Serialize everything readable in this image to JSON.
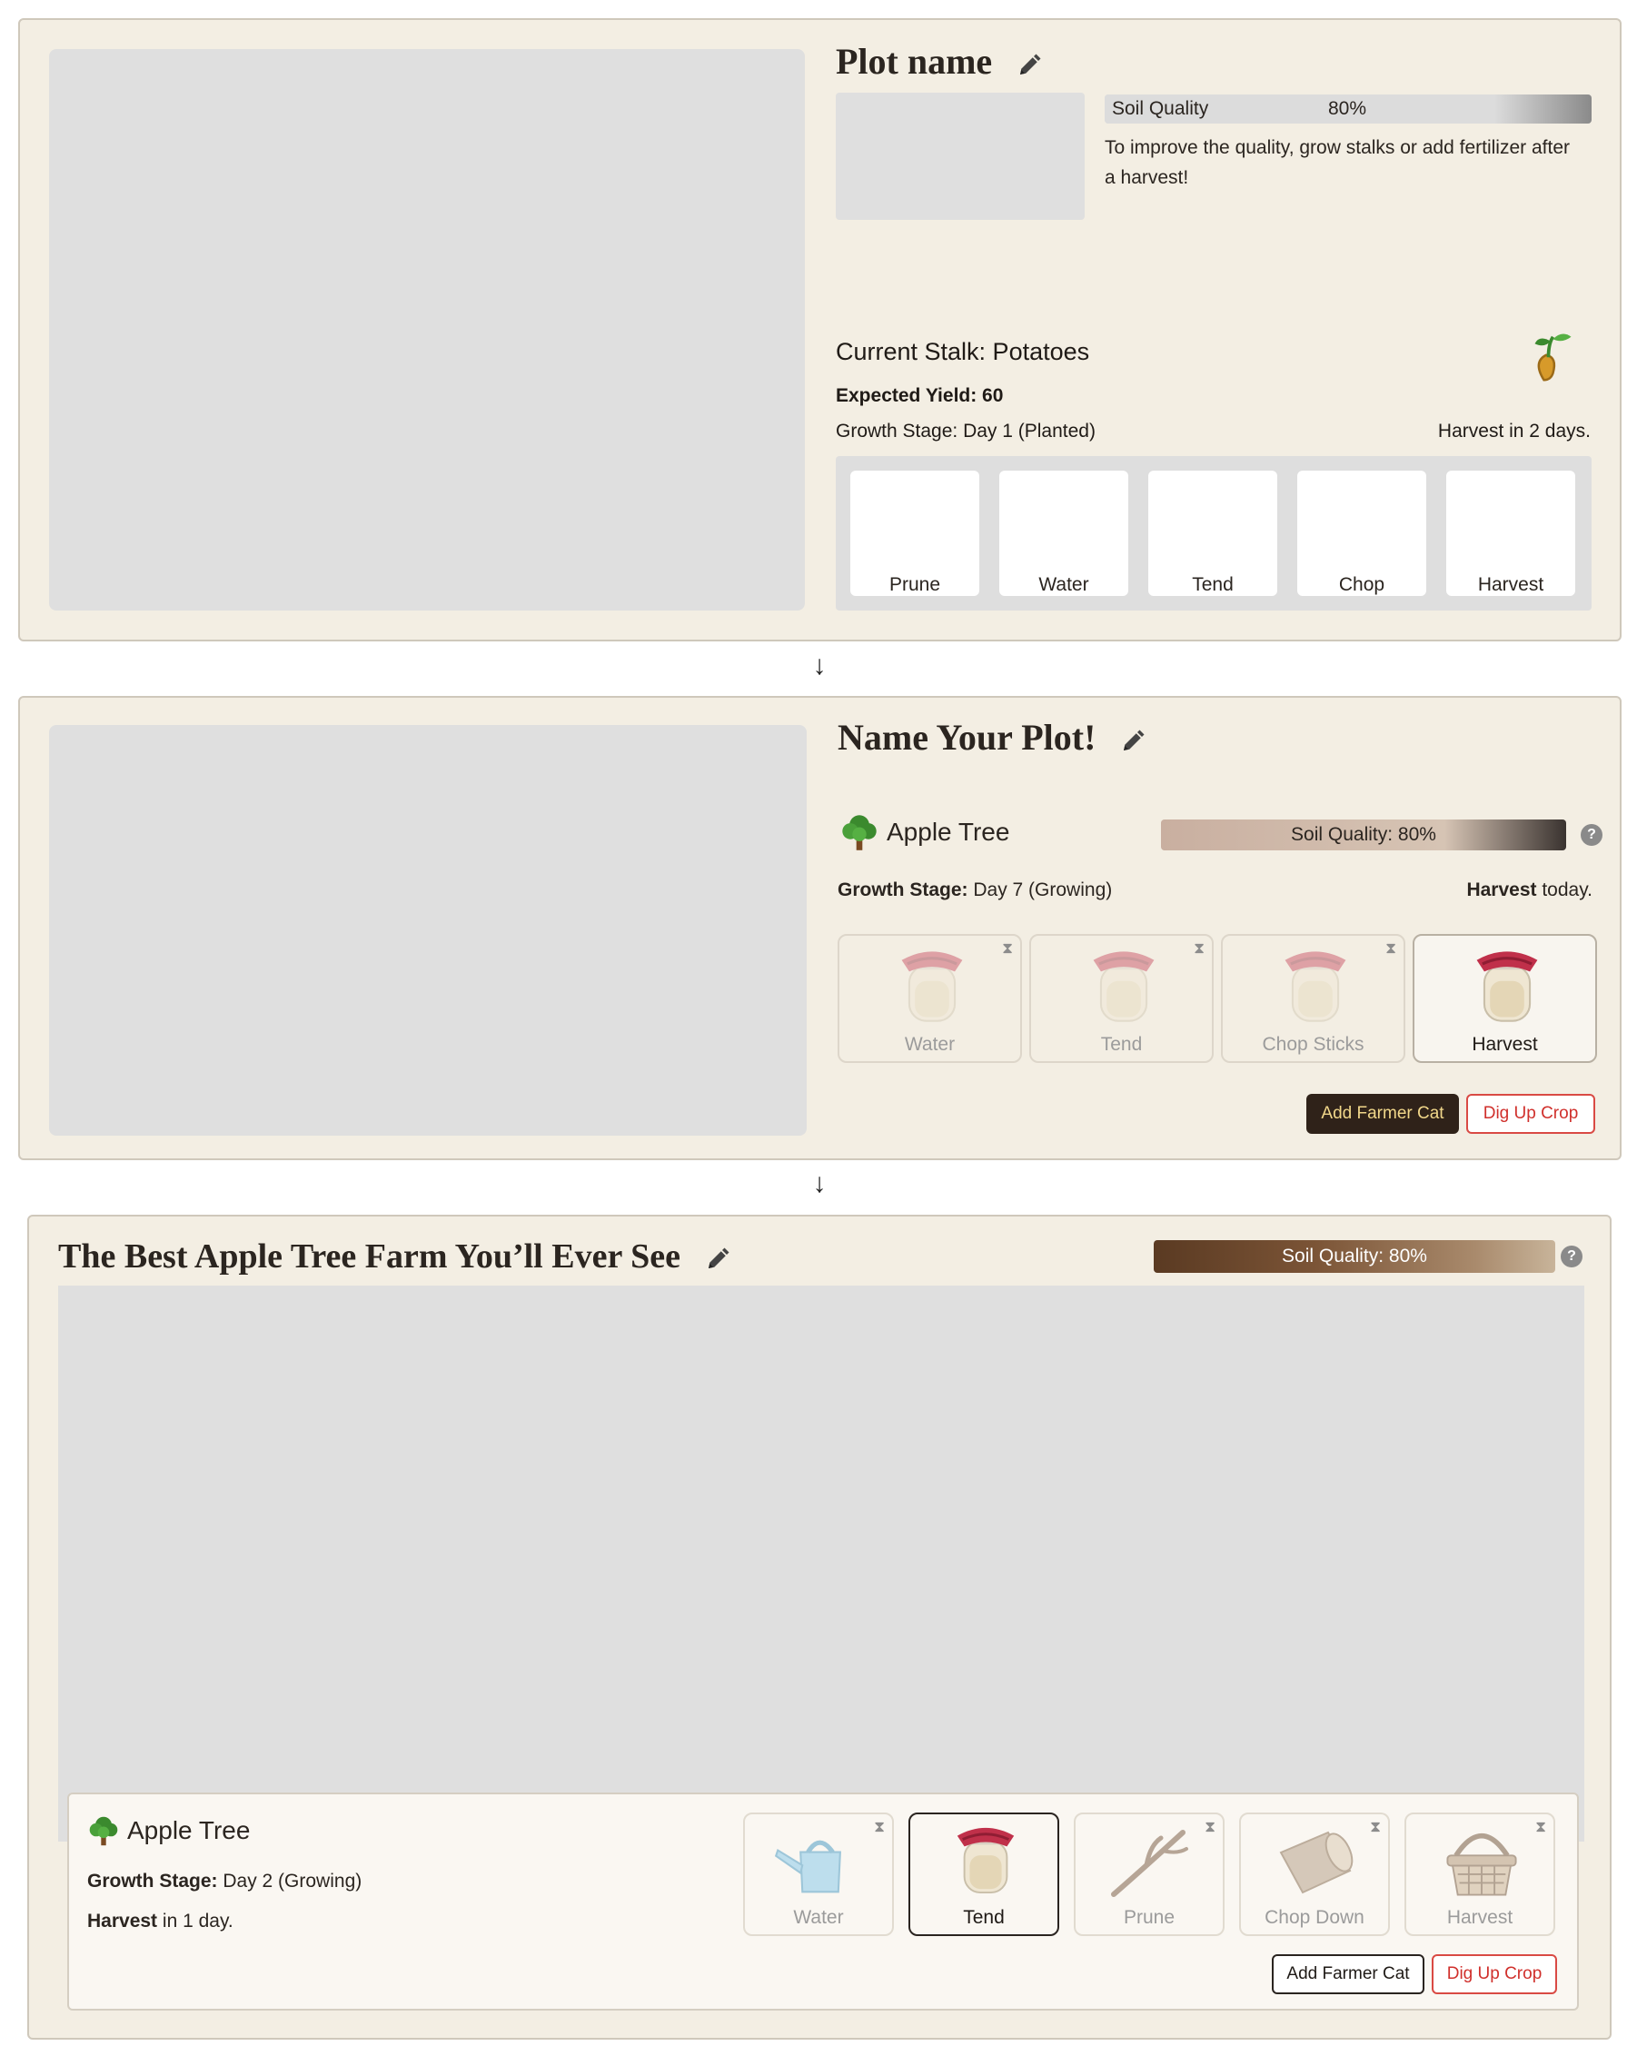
{
  "panel1": {
    "title": "Plot name",
    "soil_label": "Soil Quality",
    "soil_value": "80%",
    "soil_fraction": 0.8,
    "soil_hint": "To improve the quality, grow stalks or add fertilizer after a harvest!",
    "current_stalk": "Current Stalk: Potatoes",
    "expected_yield": "Expected Yield: 60",
    "growth_stage": "Growth Stage: Day 1 (Planted)",
    "harvest_in": "Harvest in 2 days.",
    "actions": [
      "Prune",
      "Water",
      "Tend",
      "Chop",
      "Harvest"
    ]
  },
  "arrow": "↓",
  "panel2": {
    "title": "Name Your Plot!",
    "crop_name": "Apple Tree",
    "soil_label": "Soil Quality: 80%",
    "soil_fraction": 0.8,
    "help": "?",
    "growth_label": "Growth Stage:",
    "growth_value": "Day 7 (Growing)",
    "harvest_label": "Harvest",
    "harvest_value": "today.",
    "actions": [
      {
        "label": "Water",
        "icon": "jar-icon",
        "disabled": true
      },
      {
        "label": "Tend",
        "icon": "jar-icon",
        "disabled": true
      },
      {
        "label": "Chop Sticks",
        "icon": "jar-icon",
        "disabled": true
      },
      {
        "label": "Harvest",
        "icon": "jar-icon",
        "disabled": false
      }
    ],
    "add_cat": "Add Farmer Cat",
    "dig_up": "Dig Up Crop"
  },
  "panel3": {
    "title": "The Best Apple Tree Farm You’ll Ever See",
    "soil_label": "Soil Quality: 80%",
    "soil_fraction": 0.8,
    "help": "?",
    "crop_name": "Apple Tree",
    "growth_label": "Growth Stage:",
    "growth_value": "Day 2 (Growing)",
    "harvest_label": "Harvest",
    "harvest_value": "in 1 day.",
    "actions": [
      {
        "label": "Water",
        "icon": "watering-can-icon",
        "disabled": true
      },
      {
        "label": "Tend",
        "icon": "jar-icon",
        "disabled": false,
        "selected": true
      },
      {
        "label": "Prune",
        "icon": "branch-icon",
        "disabled": true
      },
      {
        "label": "Chop Down",
        "icon": "log-icon",
        "disabled": true
      },
      {
        "label": "Harvest",
        "icon": "basket-icon",
        "disabled": true
      }
    ],
    "add_cat": "Add Farmer Cat",
    "dig_up": "Dig Up Crop"
  },
  "colors": {
    "panel_bg": "#f3eee3",
    "placeholder": "#dfdfdf",
    "dark_button": "#2f2219",
    "danger": "#d0302c"
  }
}
